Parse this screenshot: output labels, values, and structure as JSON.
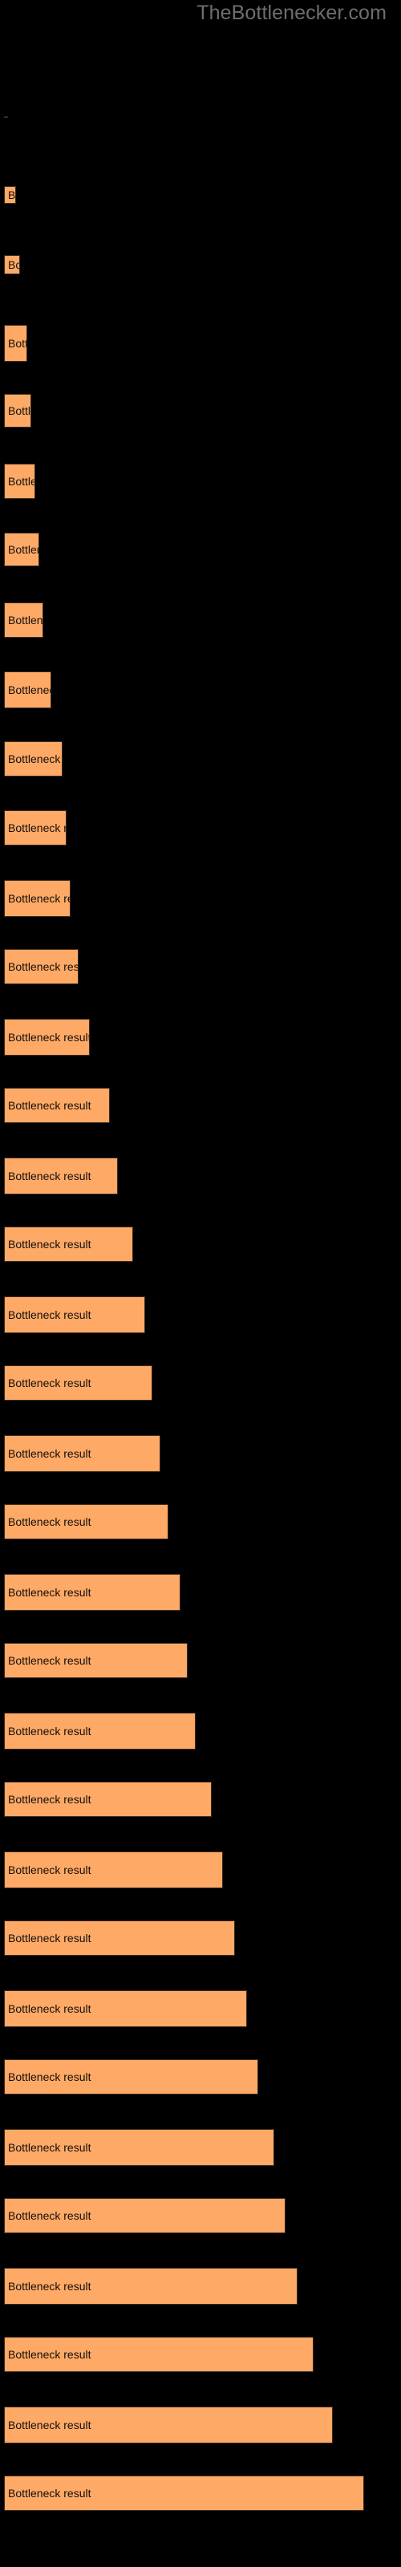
{
  "page": {
    "background_color": "#000000",
    "watermark": "TheBottlenecker.com",
    "watermark_color": "#6e6e6e"
  },
  "chart_data": {
    "type": "bar",
    "orientation": "horizontal",
    "title": "",
    "subtitle": "",
    "xlabel": "",
    "ylabel": "",
    "grid": false,
    "legend": false,
    "bar_color": "#ffa966",
    "bar_edge_color": "#3a2a1c",
    "label_color": "#140f0a",
    "bar_label_text": "Bottleneck result",
    "categories": [
      "Bottleneck result",
      "Bottleneck result",
      "Bottleneck result",
      "Bottleneck result",
      "Bottleneck result",
      "Bottleneck result",
      "Bottleneck result",
      "Bottleneck result",
      "Bottleneck result",
      "Bottleneck result",
      "Bottleneck result",
      "Bottleneck result",
      "Bottleneck result",
      "Bottleneck result",
      "Bottleneck result",
      "Bottleneck result",
      "Bottleneck result",
      "Bottleneck result",
      "Bottleneck result",
      "Bottleneck result",
      "Bottleneck result",
      "Bottleneck result",
      "Bottleneck result",
      "Bottleneck result",
      "Bottleneck result",
      "Bottleneck result",
      "Bottleneck result",
      "Bottleneck result",
      "Bottleneck result",
      "Bottleneck result",
      "Bottleneck result",
      "Bottleneck result",
      "Bottleneck result",
      "Bottleneck result",
      "Bottleneck result"
    ],
    "values": [
      1,
      3,
      4,
      6,
      7,
      8,
      9,
      10,
      12,
      15,
      16,
      17,
      19,
      22,
      27,
      29,
      33,
      36,
      38,
      40,
      42,
      45,
      47,
      49,
      53,
      56,
      59,
      62,
      65,
      69,
      72,
      75,
      79,
      84,
      92
    ],
    "xlim": [
      0,
      100
    ],
    "bars": [
      {
        "value": 1,
        "top": 145,
        "height": 2,
        "width": 3
      },
      {
        "value": 3,
        "top": 155,
        "height": 22,
        "width": 5
      },
      {
        "value": 4,
        "top": 198,
        "height": 24,
        "width": 5
      },
      {
        "value": 6,
        "top": 236,
        "height": 46,
        "width": 6
      },
      {
        "value": 7,
        "top": 279,
        "height": 42,
        "width": 8
      },
      {
        "value": 8,
        "top": 322,
        "height": 44,
        "width": 8
      },
      {
        "value": 9,
        "top": 365,
        "height": 42,
        "width": 9
      },
      {
        "value": 10,
        "top": 408,
        "height": 44,
        "width": 10
      },
      {
        "value": 12,
        "top": 452,
        "height": 46,
        "width": 12
      },
      {
        "value": 15,
        "top": 495,
        "height": 44,
        "width": 15
      },
      {
        "value": 16,
        "top": 538,
        "height": 44,
        "width": 16
      },
      {
        "value": 17,
        "top": 581,
        "height": 46,
        "width": 17
      },
      {
        "value": 19,
        "top": 624,
        "height": 44,
        "width": 19
      },
      {
        "value": 22,
        "top": 667,
        "height": 46,
        "width": 22
      },
      {
        "value": 27,
        "top": 710,
        "height": 44,
        "width": 27
      },
      {
        "value": 29,
        "top": 753,
        "height": 46,
        "width": 29
      },
      {
        "value": 33,
        "top": 796,
        "height": 44,
        "width": 33
      },
      {
        "value": 36,
        "top": 839,
        "height": 46,
        "width": 36
      },
      {
        "value": 38,
        "top": 882,
        "height": 44,
        "width": 38
      },
      {
        "value": 40,
        "top": 925,
        "height": 46,
        "width": 40
      },
      {
        "value": 42,
        "top": 968,
        "height": 44,
        "width": 42
      },
      {
        "value": 45,
        "top": 1011,
        "height": 46,
        "width": 45
      },
      {
        "value": 47,
        "top": 1054,
        "height": 44,
        "width": 47
      },
      {
        "value": 49,
        "top": 1097,
        "height": 46,
        "width": 49
      },
      {
        "value": 53,
        "top": 1140,
        "height": 44,
        "width": 53
      },
      {
        "value": 56,
        "top": 1183,
        "height": 46,
        "width": 56
      },
      {
        "value": 59,
        "top": 1226,
        "height": 44,
        "width": 59
      },
      {
        "value": 62,
        "top": 1269,
        "height": 46,
        "width": 62
      },
      {
        "value": 65,
        "top": 1312,
        "height": 44,
        "width": 65
      },
      {
        "value": 69,
        "top": 1355,
        "height": 46,
        "width": 69
      },
      {
        "value": 72,
        "top": 1398,
        "height": 44,
        "width": 72
      },
      {
        "value": 75,
        "top": 1441,
        "height": 46,
        "width": 75
      },
      {
        "value": 79,
        "top": 1484,
        "height": 44,
        "width": 79
      },
      {
        "value": 84,
        "top": 1527,
        "height": 46,
        "width": 84
      },
      {
        "value": 92,
        "top": 1570,
        "height": 44,
        "width": 92
      }
    ]
  }
}
